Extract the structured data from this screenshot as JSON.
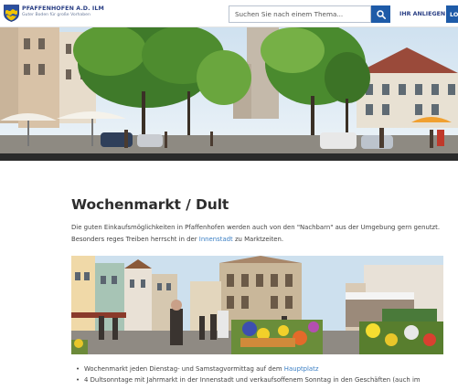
{
  "header": {
    "brand_name": "PFAFFENHOFEN A.D. ILM",
    "brand_tagline": "Guter Boden für große Vorhaben",
    "search_placeholder": "Suchen Sie nach einem Thema...",
    "anliegen_label": "IHR ANLIEGEN",
    "login_label": "LO",
    "brand_color": "#2a3f85",
    "accent_color": "#1e5ba8"
  },
  "main": {
    "title": "Wochenmarkt / Dult",
    "intro_line1": "Die guten Einkaufsmöglichkeiten in Pfaffenhofen werden auch von den \"Nachbarn\" aus der Umgebung gern genutzt.",
    "intro_line2_pre": "Besonders reges Treiben herrscht in der ",
    "intro_link": "Innenstadt",
    "intro_line2_post": " zu Marktzeiten.",
    "bullets": [
      {
        "pre": "Wochenmarkt jeden Dienstag- und Samstagvormittag auf dem ",
        "link": "Hauptplatz",
        "post": ""
      },
      {
        "pre": "4 Dultsonntage mit Jahrmarkt in der Innenstadt und verkaufsoffenem Sonntag in den Geschäften (auch im",
        "link": "",
        "post": ""
      }
    ],
    "link_color": "#3b7fc4"
  },
  "icons": {
    "logo": "coat-of-arms-icon",
    "search": "search-icon"
  }
}
